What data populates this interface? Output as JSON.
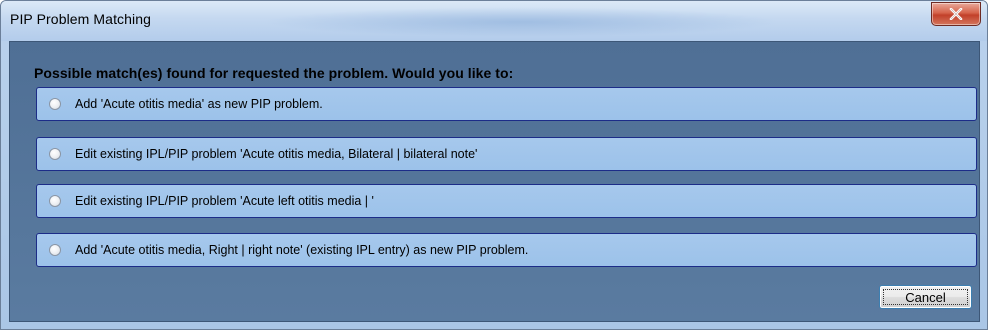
{
  "window": {
    "title": "PIP Problem Matching",
    "close_icon": "close-icon"
  },
  "dialog": {
    "prompt": "Possible match(es) found for requested the problem.   Would you like to:",
    "options": [
      {
        "label": "Add 'Acute otitis media' as new PIP problem.",
        "selected": false
      },
      {
        "label": "Edit existing IPL/PIP problem 'Acute otitis media, Bilateral | bilateral note'",
        "selected": false
      },
      {
        "label": "Edit existing IPL/PIP problem 'Acute left otitis media | '",
        "selected": false
      },
      {
        "label": "Add 'Acute otitis media, Right | right note' (existing IPL entry) as new PIP problem.",
        "selected": false
      }
    ],
    "cancel_label": "Cancel"
  },
  "colors": {
    "client_background": "#5a7ba0",
    "option_background": "#a6c8ec",
    "option_border": "#1c2c88",
    "close_button": "#c2402a"
  }
}
